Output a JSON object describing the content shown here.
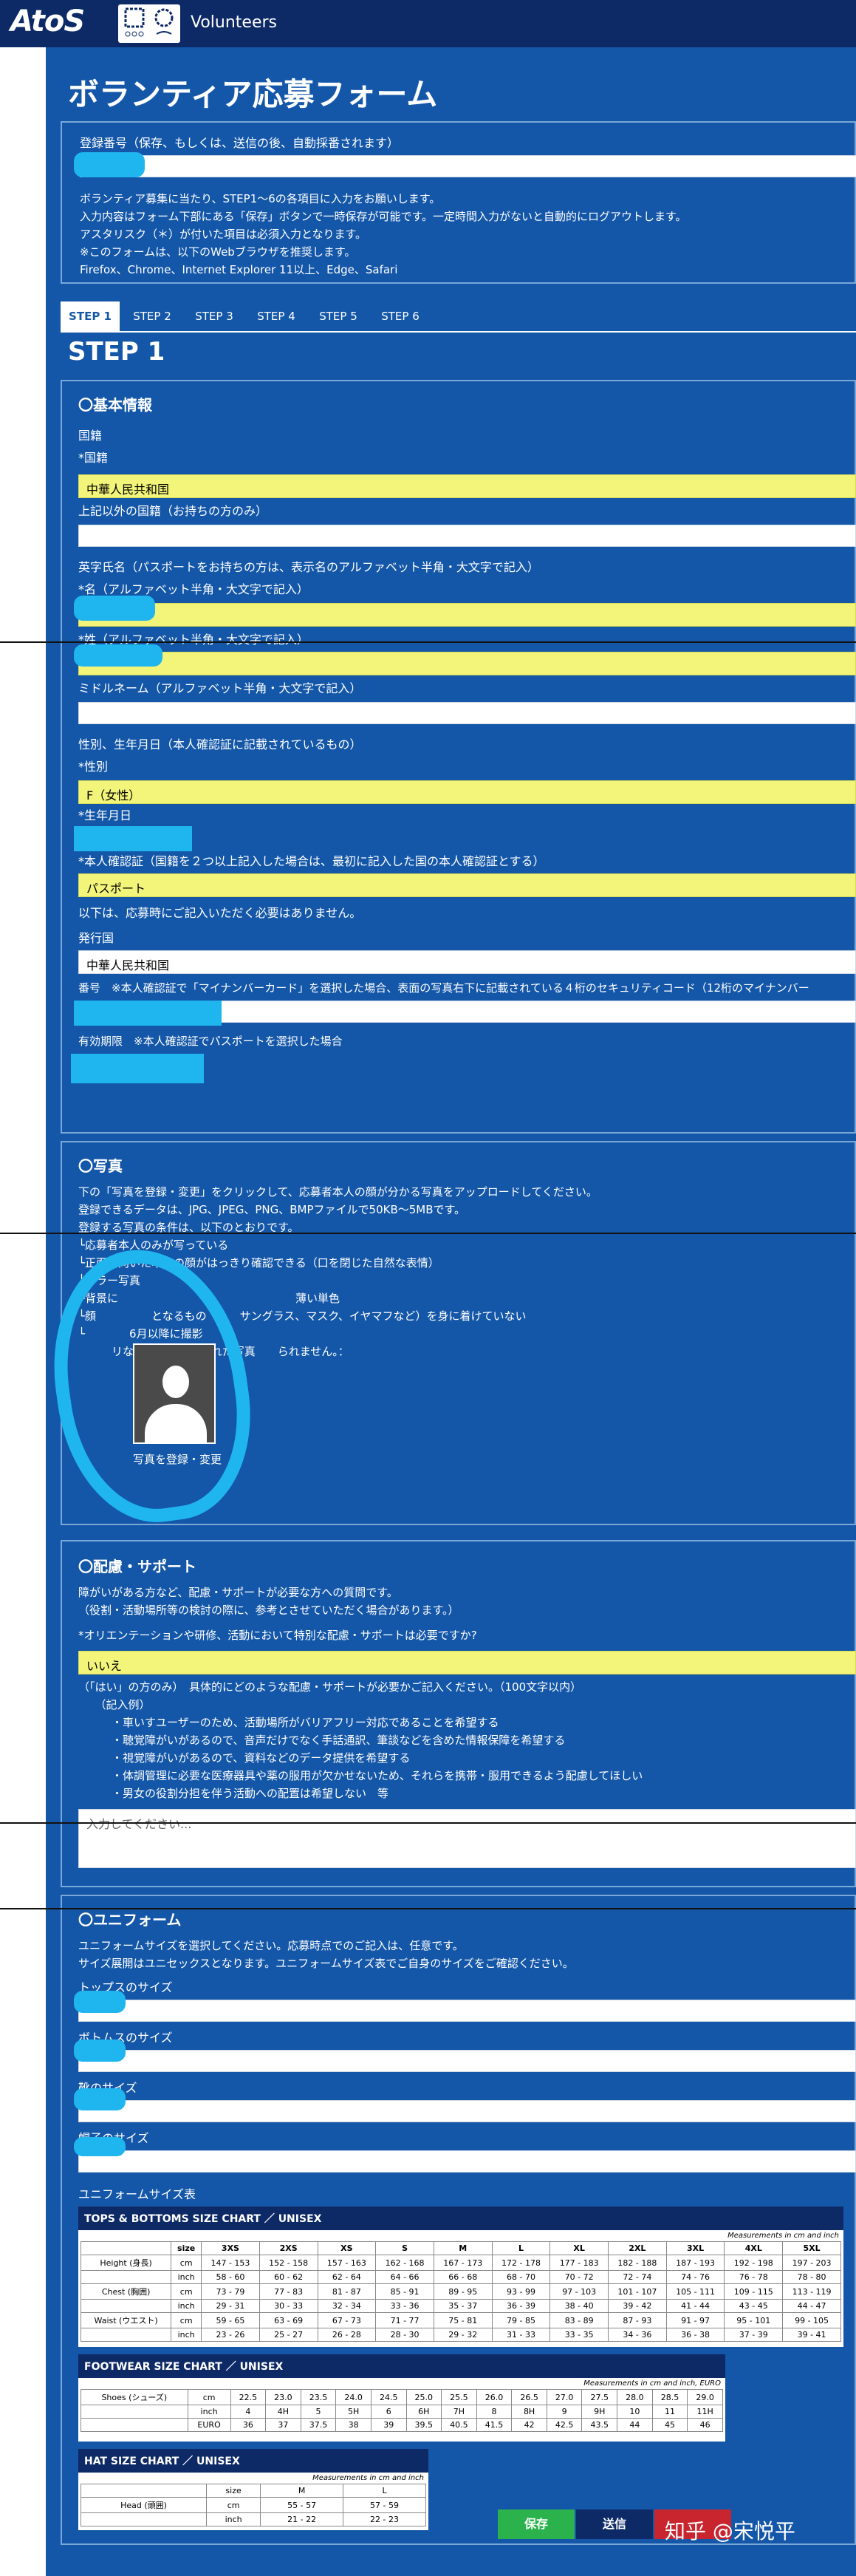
{
  "header": {
    "brand": "AtoS",
    "title": "Volunteers"
  },
  "form": {
    "title": "ボランティア応募フォーム"
  },
  "intro": {
    "reg_label": "登録番号（保存、もしくは、送信の後、自動採番されます）",
    "lines": [
      "ボランティア募集に当たり、STEP1～6の各項目に入力をお願いします。",
      "入力内容はフォーム下部にある「保存」ボタンで一時保存が可能です。一定時間入力がないと自動的にログアウトします。",
      "アスタリスク（＊）が付いた項目は必須入力となります。",
      "※このフォームは、以下のWebブラウザを推奨します。",
      "Firefox、Chrome、Internet Explorer 11以上、Edge、Safari"
    ]
  },
  "tabs": [
    "STEP 1",
    "STEP 2",
    "STEP 3",
    "STEP 4",
    "STEP 5",
    "STEP 6"
  ],
  "step_title": "STEP 1",
  "basic": {
    "heading": "〇基本情報",
    "nationality": "国籍",
    "nationality_req": "*国籍",
    "nationality_value": "中華人民共和国",
    "other_nationality": "上記以外の国籍（お持ちの方のみ）",
    "english_name": "英字氏名（パスポートをお持ちの方は、表示名のアルファベット半角・大文字で記入）",
    "first_name": "*名（アルファベット半角・大文字で記入）",
    "last_name": "*姓（アルファベット半角・大文字で記入）",
    "middle_name": "ミドルネーム（アルファベット半角・大文字で記入）",
    "sex_dob": "性別、生年月日（本人確認証に記載されているもの）",
    "sex_label": "*性別",
    "sex_value": "F（女性）",
    "dob_label": "*生年月日",
    "id_label": "*本人確認証（国籍を２つ以上記入した場合は、最初に記入した国の本人確認証とする）",
    "id_value": "パスポート",
    "note": "以下は、応募時にご記入いただく必要はありません。",
    "issue_label": "発行国",
    "issue_value": "中華人民共和国",
    "number_label": "番号　※本人確認証で「マイナンバーカード」を選択した場合、表面の写真右下に記載されている４桁のセキュリティコード（12桁のマイナンバー",
    "expiry_label": "有効期限　※本人確認証でパスポートを選択した場合"
  },
  "photo": {
    "heading": "〇写真",
    "lines": [
      "下の「写真を登録・変更」をクリックして、応募者本人の顔が分かる写真をアップロードしてください。",
      "登録できるデータは、JPG、JPEG、PNG、BMPファイルで50KB～5MBです。",
      "登録する写真の条件は、以下のとおりです。",
      "└応募者本人のみが写っている",
      "└正面を向いた本人の顔がはっきり確認できる（口を閉じた自然な表情）",
      "└カラー写真",
      "└背景に　　　　　　　　　　　　　　　　薄い単色",
      "└顔　　　　　となるもの（　　サングラス、マスク、イヤマフなど）を身に着けていない",
      "└　　　　6月以降に撮影",
      "　　　リなどにより加工された写真　　られません。："
    ],
    "button": "写真を登録・変更"
  },
  "support": {
    "heading": "〇配慮・サポート",
    "lines": [
      "障がいがある方など、配慮・サポートが必要な方への質問です。",
      "（役割・活動場所等の検討の際に、参考とさせていただく場合があります。）"
    ],
    "question": "*オリエンテーションや研修、活動において特別な配慮・サポートは必要ですか?",
    "answer": "いいえ",
    "detail_lines": [
      "（「はい」の方のみ）　具体的にどのような配慮・サポートが必要かご記入ください。（100文字以内）",
      "　　（記入例）",
      "　　　・車いすユーザーのため、活動場所がバリアフリー対応であることを希望する",
      "　　　・聴覚障がいがあるので、音声だけでなく手話通訳、筆談などを含めた情報保障を希望する",
      "　　　・視覚障がいがあるので、資料などのデータ提供を希望する",
      "　　　・体調管理に必要な医療器具や薬の服用が欠かせないため、それらを携帯・服用できるよう配慮してほしい",
      "　　　・男女の役割分担を伴う活動への配置は希望しない　等"
    ],
    "placeholder": "入力してください..."
  },
  "uniform": {
    "heading": "〇ユニフォーム",
    "lines": [
      "ユニフォームサイズを選択してください。応募時点でのご記入は、任意です。",
      "サイズ展開はユニセックスとなります。ユニフォームサイズ表でご自身のサイズをご確認ください。"
    ],
    "tops": "トップスのサイズ",
    "bottoms": "ボトムスのサイズ",
    "shoes": "靴のサイズ",
    "hat": "帽子のサイズ",
    "chart_label": "ユニフォームサイズ表"
  },
  "tops_chart": {
    "title": "TOPS & BOTTOMS  SIZE CHART ／ UNISEX",
    "note": "Measurements in cm and inch",
    "sizes": [
      "size",
      "3XS",
      "2XS",
      "XS",
      "S",
      "M",
      "L",
      "XL",
      "2XL",
      "3XL",
      "4XL",
      "5XL"
    ],
    "rows": [
      [
        "Height (身長)",
        "cm",
        "147 - 153",
        "152 - 158",
        "157 - 163",
        "162 - 168",
        "167 - 173",
        "172 - 178",
        "177 - 183",
        "182 - 188",
        "187 - 193",
        "192 - 198",
        "197 - 203"
      ],
      [
        "",
        "inch",
        "58 - 60",
        "60 - 62",
        "62 - 64",
        "64 - 66",
        "66 - 68",
        "68 - 70",
        "70 - 72",
        "72 - 74",
        "74 - 76",
        "76 - 78",
        "78 - 80"
      ],
      [
        "Chest (胸囲)",
        "cm",
        "73 - 79",
        "77 - 83",
        "81 - 87",
        "85 - 91",
        "89 - 95",
        "93 - 99",
        "97 - 103",
        "101 - 107",
        "105 - 111",
        "109 - 115",
        "113 - 119"
      ],
      [
        "",
        "inch",
        "29 - 31",
        "30 - 33",
        "32 - 34",
        "33 - 36",
        "35 - 37",
        "36 - 39",
        "38 - 40",
        "39 - 42",
        "41 - 44",
        "43 - 45",
        "44 - 47"
      ],
      [
        "Waist (ウエスト)",
        "cm",
        "59 - 65",
        "63 - 69",
        "67 - 73",
        "71 - 77",
        "75 - 81",
        "79 - 85",
        "83 - 89",
        "87 - 93",
        "91 - 97",
        "95 - 101",
        "99 - 105"
      ],
      [
        "",
        "inch",
        "23 - 26",
        "25 - 27",
        "26 - 28",
        "28 - 30",
        "29 - 32",
        "31 - 33",
        "33 - 35",
        "34 - 36",
        "36 - 38",
        "37 - 39",
        "39 - 41"
      ]
    ]
  },
  "foot_chart": {
    "title": "FOOTWEAR  SIZE CHART ／ UNISEX",
    "note": "Measurements in cm and inch, EURO",
    "label": "Shoes (シューズ)",
    "cm": [
      "cm",
      "22.5",
      "23.0",
      "23.5",
      "24.0",
      "24.5",
      "25.0",
      "25.5",
      "26.0",
      "26.5",
      "27.0",
      "27.5",
      "28.0",
      "28.5",
      "29.0"
    ],
    "inch": [
      "inch",
      "4",
      "4H",
      "5",
      "5H",
      "6",
      "6H",
      "7H",
      "8",
      "8H",
      "9",
      "9H",
      "10",
      "11",
      "11H"
    ],
    "euro": [
      "EURO",
      "36",
      "37",
      "37.5",
      "38",
      "39",
      "39.5",
      "40.5",
      "41.5",
      "42",
      "42.5",
      "43.5",
      "44",
      "45",
      "46"
    ]
  },
  "hat_chart": {
    "title": "HAT  SIZE CHART ／ UNISEX",
    "note": "Measurements in cm and inch",
    "head": [
      "size",
      "M",
      "L"
    ],
    "label": "Head (頭囲)",
    "cm": [
      "cm",
      "55 - 57",
      "57 - 59"
    ],
    "inch": [
      "inch",
      "21 - 22",
      "22 - 23"
    ]
  },
  "footer": {
    "save": "保存",
    "send": "送信",
    "watermark": "知乎 @宋悦平"
  },
  "colors": {
    "main": "#1457a8",
    "top": "#0d2a66",
    "highlight": "#f2f57a",
    "save": "#2bb24c",
    "redact": "#1fb6f0"
  }
}
